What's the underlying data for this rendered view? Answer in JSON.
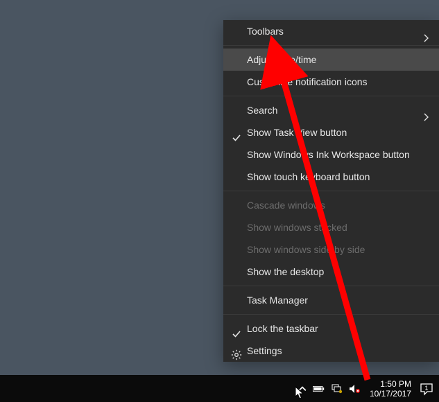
{
  "context_menu": {
    "items": [
      {
        "label": "Toolbars",
        "submenu": true
      },
      {
        "sep": true
      },
      {
        "label": "Adjust date/time",
        "hover": true
      },
      {
        "label": "Customize notification icons"
      },
      {
        "sep": true
      },
      {
        "label": "Search",
        "submenu": true
      },
      {
        "label": "Show Task View button",
        "checked": true
      },
      {
        "label": "Show Windows Ink Workspace button"
      },
      {
        "label": "Show touch keyboard button"
      },
      {
        "sep": true
      },
      {
        "label": "Cascade windows",
        "disabled": true
      },
      {
        "label": "Show windows stacked",
        "disabled": true
      },
      {
        "label": "Show windows side by side",
        "disabled": true
      },
      {
        "label": "Show the desktop"
      },
      {
        "sep": true
      },
      {
        "label": "Task Manager"
      },
      {
        "sep": true
      },
      {
        "label": "Lock the taskbar",
        "checked": true
      },
      {
        "label": "Settings",
        "icon": "gear"
      }
    ]
  },
  "taskbar": {
    "clock_time": "1:50 PM",
    "clock_date": "10/17/2017",
    "notification_count": "1"
  },
  "annotation": {
    "arrow_color": "#ff0000"
  }
}
